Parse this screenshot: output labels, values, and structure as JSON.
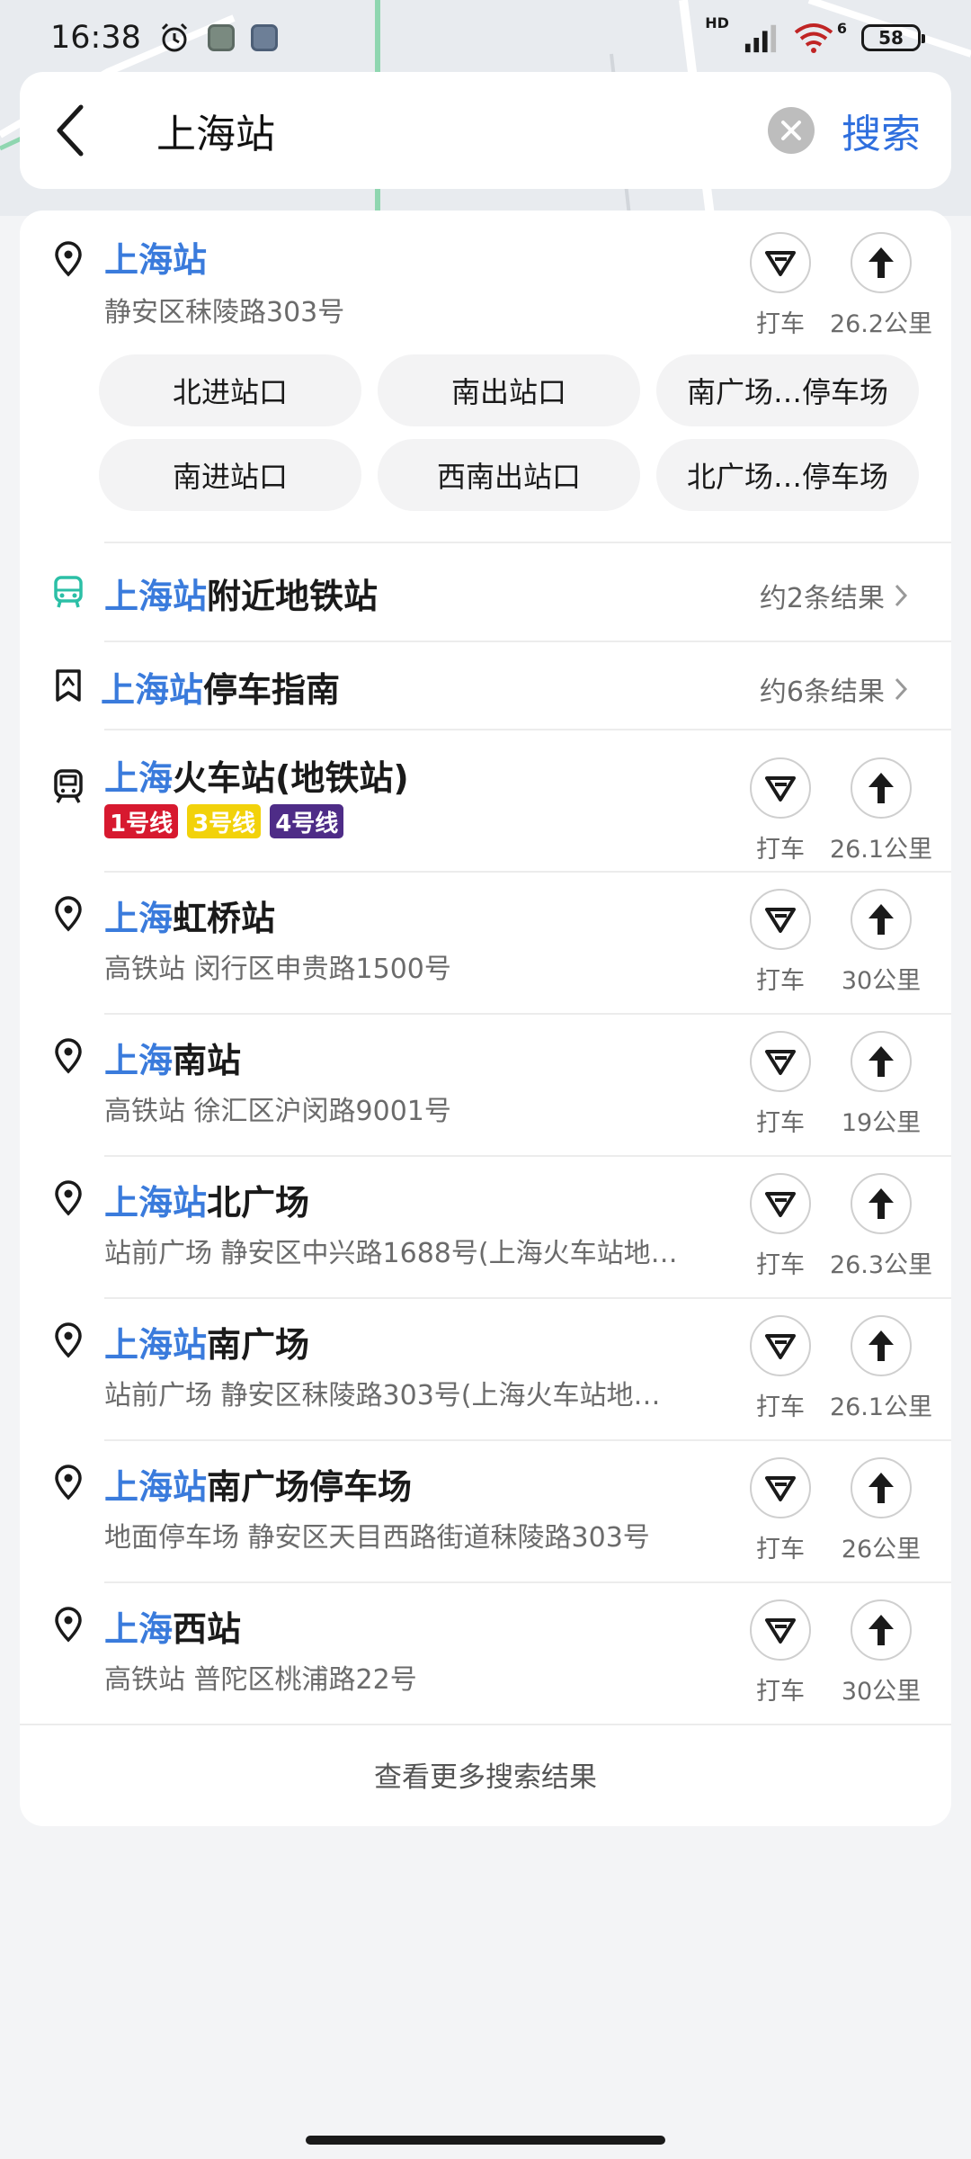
{
  "status_bar": {
    "time": "16:38",
    "network": "HD",
    "wifi_num": "6",
    "battery": "58"
  },
  "search": {
    "query": "上海站",
    "button": "搜索"
  },
  "top_result": {
    "title_hl": "上海站",
    "title_rest": "",
    "address": "静安区秣陵路303号",
    "taxi": "打车",
    "distance": "26.2公里",
    "chips": [
      "北进站口",
      "南出站口",
      "南广场…停车场",
      "南进站口",
      "西南出站口",
      "北广场…停车场"
    ]
  },
  "nearby": {
    "metro": {
      "title_hl": "上海站",
      "title_rest": "附近地铁站",
      "count": "约2条结果"
    },
    "parking": {
      "title_hl": "上海站",
      "title_rest": "停车指南",
      "count": "约6条结果"
    }
  },
  "metro_station": {
    "title_hl": "上海",
    "title_rest": "火车站(地铁站)",
    "lines": [
      {
        "label": "1号线",
        "color": "#d7192f"
      },
      {
        "label": "3号线",
        "color": "#f2d20a"
      },
      {
        "label": "4号线",
        "color": "#4e2c87"
      }
    ],
    "taxi": "打车",
    "distance": "26.1公里"
  },
  "results": [
    {
      "title_hl": "上海",
      "title_rest": "虹桥站",
      "sub": "高铁站  闵行区申贵路1500号",
      "taxi": "打车",
      "distance": "30公里"
    },
    {
      "title_hl": "上海",
      "title_rest": "南站",
      "sub": "高铁站  徐汇区沪闵路9001号",
      "taxi": "打车",
      "distance": "19公里"
    },
    {
      "title_hl": "上海站",
      "title_rest": "北广场",
      "sub": "站前广场  静安区中兴路1688号(上海火车站地…",
      "taxi": "打车",
      "distance": "26.3公里"
    },
    {
      "title_hl": "上海站",
      "title_rest": "南广场",
      "sub": "站前广场  静安区秣陵路303号(上海火车站地…",
      "taxi": "打车",
      "distance": "26.1公里"
    },
    {
      "title_hl": "上海站",
      "title_rest": "南广场停车场",
      "sub": "地面停车场  静安区天目西路街道秣陵路303号",
      "taxi": "打车",
      "distance": "26公里"
    },
    {
      "title_hl": "上海",
      "title_rest": "西站",
      "sub": "高铁站  普陀区桃浦路22号",
      "taxi": "打车",
      "distance": "30公里"
    }
  ],
  "more_results": "查看更多搜索结果",
  "colors": {
    "accent": "#3a7bdc",
    "search_blue": "#2f6fde"
  }
}
